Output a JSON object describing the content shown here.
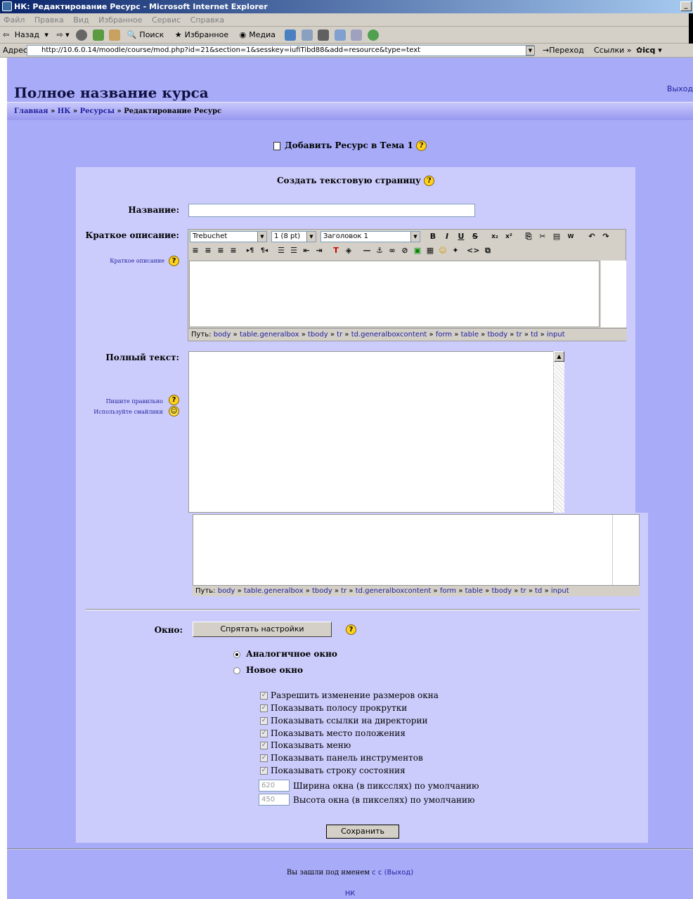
{
  "window": {
    "title": "НК: Редактирование Ресурс - Microsoft Internet Explorer"
  },
  "menu": [
    "Файл",
    "Правка",
    "Вид",
    "Избранное",
    "Сервис",
    "Справка"
  ],
  "toolbar": {
    "back": "Назад",
    "search": "Поиск",
    "favorites": "Избранное",
    "media": "Медиа"
  },
  "address": {
    "label": "Адрес:",
    "url": "http://10.6.0.14/moodle/course/mod.php?id=21&section=1&sesskey=iufiTibd88&add=resource&type=text",
    "go": "Переход",
    "links": "Ссылки",
    "icq": "icq"
  },
  "header": {
    "course_title": "Полное название курса",
    "logout": "Выход"
  },
  "breadcrumb": {
    "home": "Главная",
    "course": "НК",
    "resources": "Ресурсы",
    "current": "Редактирование Ресурс",
    "sep": "»"
  },
  "heading": "Добавить Ресурс в Тема 1",
  "form": {
    "subtitle": "Создать текстовую страницу",
    "name_label": "Название:",
    "summary_label": "Краткое описание:",
    "summary_help": "Краткое описание",
    "fulltext_label": "Полный текст:",
    "help_write": "Пишите правильно",
    "help_smilies": "Используйте смайлики",
    "font": "Trebuchet",
    "size": "1 (8 pt)",
    "format": "Заголовок 1",
    "path_label": "Путь:",
    "path": [
      "body",
      "table.generalbox",
      "tbody",
      "tr",
      "td.generalboxcontent",
      "form",
      "table",
      "tbody",
      "tr",
      "td",
      "input"
    ],
    "window_label": "Окно:",
    "hide_settings": "Спрятать настройки",
    "radio_same": "Аналогичное окно",
    "radio_new": "Новое окно",
    "options": [
      "Разрешить изменение размеров окна",
      "Показывать полосу прокрутки",
      "Показывать ссылки на директории",
      "Показывать место положения",
      "Показывать меню",
      "Показывать панель инструментов",
      "Показывать строку состояния"
    ],
    "width_value": "620",
    "width_label": "Ширина окна (в пиксслях) по умолчанию",
    "height_value": "450",
    "height_label": "Высота окна (в пикселях) по умолчанию",
    "save": "Сохранить"
  },
  "footer": {
    "logged_in": "Вы зашли под именем",
    "user": "с с",
    "logout": "(Выход)",
    "home": "НК"
  }
}
